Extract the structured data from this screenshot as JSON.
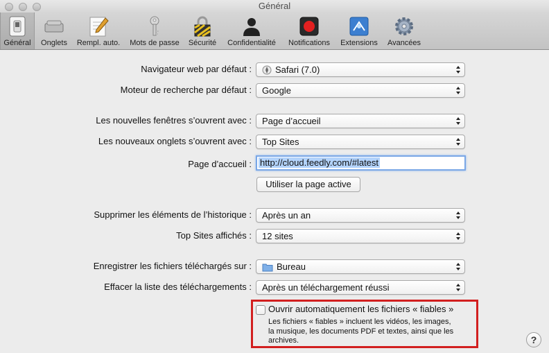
{
  "window": {
    "title": "Général"
  },
  "toolbar": {
    "items": [
      {
        "label": "Général",
        "icon": "switch-icon",
        "selected": true
      },
      {
        "label": "Onglets",
        "icon": "tabs-icon"
      },
      {
        "label": "Rempl. auto.",
        "icon": "autofill-pencil-icon"
      },
      {
        "label": "Mots de passe",
        "icon": "key-icon"
      },
      {
        "label": "Sécurité",
        "icon": "lock-icon"
      },
      {
        "label": "Confidentialité",
        "icon": "silhouette-icon"
      },
      {
        "label": "Notifications",
        "icon": "notification-record-icon"
      },
      {
        "label": "Extensions",
        "icon": "puzzle-extensions-icon"
      },
      {
        "label": "Avancées",
        "icon": "gear-icon"
      }
    ]
  },
  "settings": {
    "default_browser": {
      "label": "Navigateur web par défaut :",
      "value": "Safari (7.0)"
    },
    "search_engine": {
      "label": "Moteur de recherche par défaut :",
      "value": "Google"
    },
    "new_windows": {
      "label": "Les nouvelles fenêtres s’ouvrent avec :",
      "value": "Page d’accueil"
    },
    "new_tabs": {
      "label": "Les nouveaux onglets s’ouvrent avec :",
      "value": "Top Sites"
    },
    "homepage": {
      "label": "Page d’accueil :",
      "value": "http://cloud.feedly.com/#latest"
    },
    "use_current_page": {
      "label": "Utiliser la page active"
    },
    "history": {
      "label": "Supprimer les éléments de l’historique :",
      "value": "Après un an"
    },
    "top_sites": {
      "label": "Top Sites affichés :",
      "value": "12 sites"
    },
    "download_location": {
      "label": "Enregistrer les fichiers téléchargés sur :",
      "value": "Bureau"
    },
    "clear_downloads": {
      "label": "Effacer la liste des téléchargements :",
      "value": "Après un téléchargement réussi"
    },
    "open_safe_files": {
      "label": "Ouvrir automatiquement les fichiers « fiables »",
      "checked": false,
      "description": "Les fichiers « fiables » incluent les vidéos, les images, la musique, les documents PDF et textes, ainsi que les archives."
    },
    "help": {
      "label": "?"
    }
  },
  "colors": {
    "highlight_box": "#d21f1f",
    "focus_ring": "#7aa7e6"
  }
}
